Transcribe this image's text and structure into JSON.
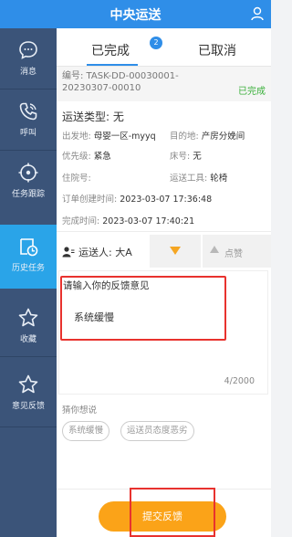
{
  "app": {
    "title": "中央运送"
  },
  "sidebar": {
    "items": [
      {
        "label": "消息",
        "icon": "message-icon"
      },
      {
        "label": "呼叫",
        "icon": "phone-icon"
      },
      {
        "label": "任务跟踪",
        "icon": "track-icon"
      },
      {
        "label": "历史任务",
        "icon": "history-icon",
        "active": true
      },
      {
        "label": "收藏",
        "icon": "star-icon"
      },
      {
        "label": "意见反馈",
        "icon": "feedback-star-icon"
      }
    ]
  },
  "tabs": {
    "completed": "已完成",
    "cancelled": "已取消",
    "badge": "2"
  },
  "task": {
    "code": "编号: TASK-DD-00030001-20230307-00010",
    "status": "已完成",
    "type_label": "运送类型: 无",
    "origin_label": "出发地:",
    "origin": "母婴一区-myyq",
    "dest_label": "目的地:",
    "dest": "产房分娩间",
    "priority_label": "优先级:",
    "priority": "紧急",
    "bed_label": "床号:",
    "bed": "无",
    "inpatient_label": "住院号:",
    "tool_label": "运送工具:",
    "tool": "轮椅",
    "created_label": "订单创建时间:",
    "created": "2023-03-07 17:36:48",
    "done_label": "完成时间:",
    "done": "2023-03-07 17:40:21"
  },
  "carrier": {
    "label": "运送人: 大A",
    "like": "点赞"
  },
  "feedback": {
    "prompt": "请输入你的反馈意见",
    "text": "系统缓慢",
    "count": "4/2000"
  },
  "guess": {
    "label": "猜你想说",
    "chips": [
      "系统缓慢",
      "运送员态度恶劣"
    ]
  },
  "submit": {
    "label": "提交反馈"
  },
  "colors": {
    "primary": "#2f8ee8",
    "sidebar": "#3b5479",
    "active": "#2aa4e8",
    "submit": "#fba318",
    "highlight": "#e8322e",
    "done": "#3ab03a"
  }
}
